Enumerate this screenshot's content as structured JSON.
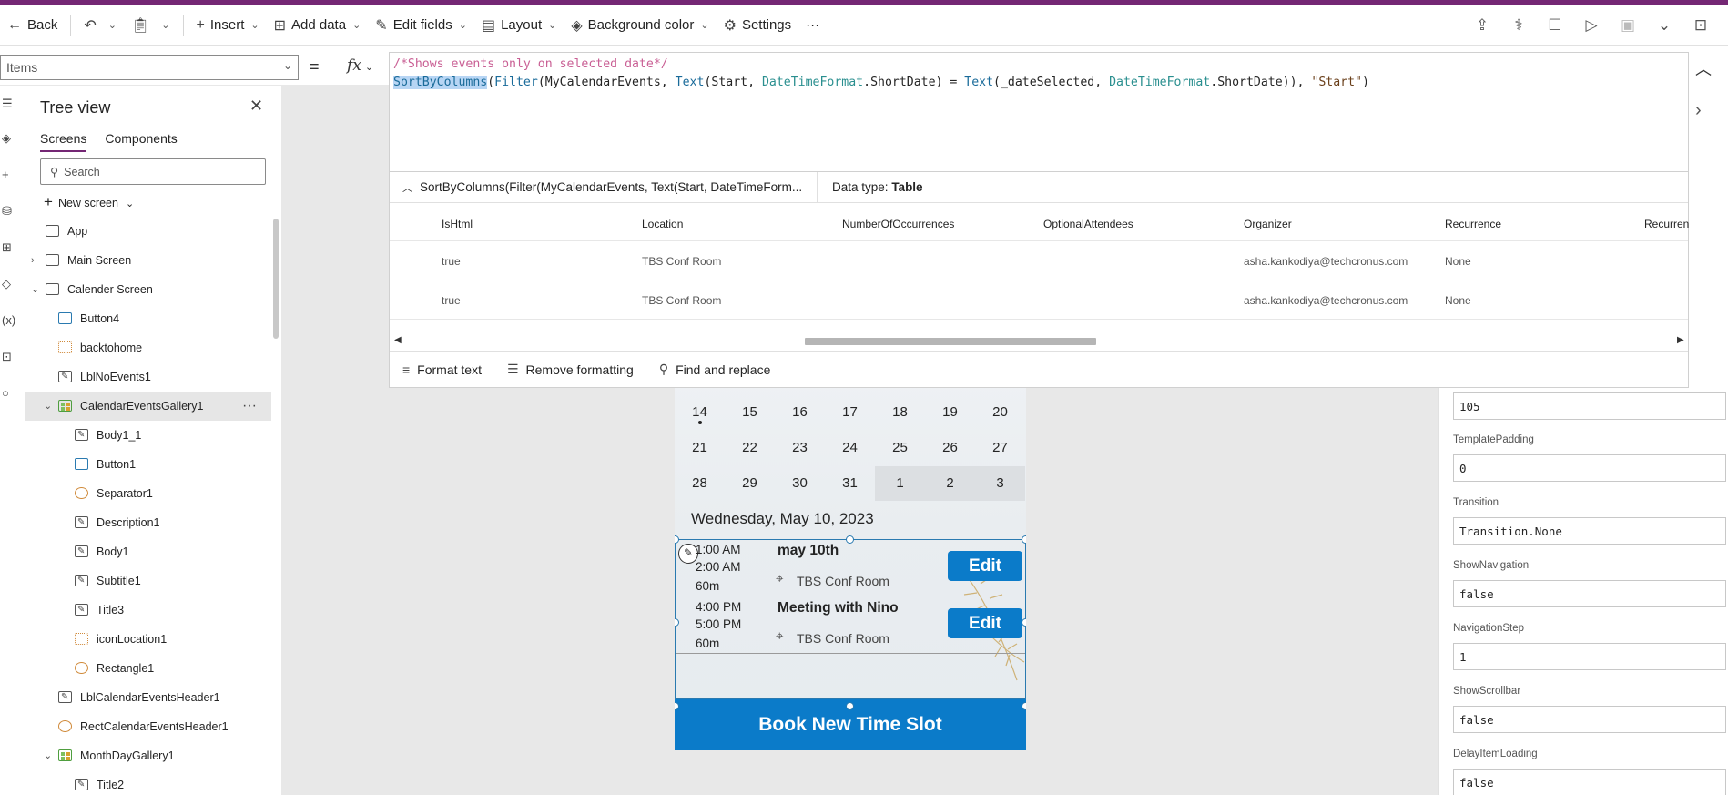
{
  "toolbar": {
    "back": "Back",
    "insert": "Insert",
    "add_data": "Add data",
    "edit_fields": "Edit fields",
    "layout": "Layout",
    "background_color": "Background color",
    "settings": "Settings",
    "more": "···"
  },
  "formula": {
    "property": "Items",
    "equals": "=",
    "fx": "fx",
    "comment": "/*Shows events only on selected date*/",
    "code_sel": "SortByColumns",
    "code_p1": "(",
    "code_fn2": "Filter",
    "code_p2": "(MyCalendarEvents, ",
    "code_fn3": "Text",
    "code_p3": "(Start, ",
    "code_tk1": "DateTimeFormat",
    "code_p4": ".ShortDate) = ",
    "code_fn4": "Text",
    "code_p5": "(_dateSelected, ",
    "code_tk2": "DateTimeFormat",
    "code_p6": ".ShortDate)), ",
    "code_str": "\"Start\"",
    "code_p7": ")"
  },
  "results": {
    "expression": "SortByColumns(Filter(MyCalendarEvents, Text(Start, DateTimeForm...",
    "data_type_label": "Data type:",
    "data_type": "Table",
    "columns": [
      "IsHtml",
      "Location",
      "NumberOfOccurrences",
      "OptionalAttendees",
      "Organizer",
      "Recurrence",
      "Recurren"
    ],
    "rows": [
      [
        "true",
        "TBS Conf Room",
        "",
        "",
        "asha.kankodiya@techcronus.com",
        "None",
        ""
      ],
      [
        "true",
        "TBS Conf Room",
        "",
        "",
        "asha.kankodiya@techcronus.com",
        "None",
        ""
      ]
    ],
    "format_text": "Format text",
    "remove_formatting": "Remove formatting",
    "find_replace": "Find and replace"
  },
  "tree": {
    "title": "Tree view",
    "tab_screens": "Screens",
    "tab_components": "Components",
    "search_placeholder": "Search",
    "new_screen": "New screen",
    "items": [
      {
        "label": "App"
      },
      {
        "label": "Main Screen"
      },
      {
        "label": "Calender Screen"
      },
      {
        "label": "Button4"
      },
      {
        "label": "backtohome"
      },
      {
        "label": "LblNoEvents1"
      },
      {
        "label": "CalendarEventsGallery1"
      },
      {
        "label": "Body1_1"
      },
      {
        "label": "Button1"
      },
      {
        "label": "Separator1"
      },
      {
        "label": "Description1"
      },
      {
        "label": "Body1"
      },
      {
        "label": "Subtitle1"
      },
      {
        "label": "Title3"
      },
      {
        "label": "iconLocation1"
      },
      {
        "label": "Rectangle1"
      },
      {
        "label": "LblCalendarEventsHeader1"
      },
      {
        "label": "RectCalendarEventsHeader1"
      },
      {
        "label": "MonthDayGallery1"
      },
      {
        "label": "Title2"
      }
    ]
  },
  "app": {
    "cal_rows": [
      [
        "14",
        "15",
        "16",
        "17",
        "18",
        "19",
        "20"
      ],
      [
        "21",
        "22",
        "23",
        "24",
        "25",
        "26",
        "27"
      ],
      [
        "28",
        "29",
        "30",
        "31",
        "1",
        "2",
        "3"
      ]
    ],
    "selected_date": "Wednesday, May 10, 2023",
    "events": [
      {
        "start": "1:00 AM",
        "end": "2:00 AM",
        "duration": "60m",
        "title": "may 10th",
        "location": "TBS Conf Room",
        "edit": "Edit"
      },
      {
        "start": "4:00 PM",
        "end": "5:00 PM",
        "duration": "60m",
        "title": "Meeting with Nino",
        "location": "TBS Conf Room",
        "edit": "Edit"
      }
    ],
    "book_button": "Book New Time Slot"
  },
  "properties": [
    {
      "label": "",
      "value": "105"
    },
    {
      "label": "TemplatePadding",
      "value": "0"
    },
    {
      "label": "Transition",
      "value": "Transition.None"
    },
    {
      "label": "ShowNavigation",
      "value": "false"
    },
    {
      "label": "NavigationStep",
      "value": "1"
    },
    {
      "label": "ShowScrollbar",
      "value": "false"
    },
    {
      "label": "DelayItemLoading",
      "value": "false"
    }
  ]
}
